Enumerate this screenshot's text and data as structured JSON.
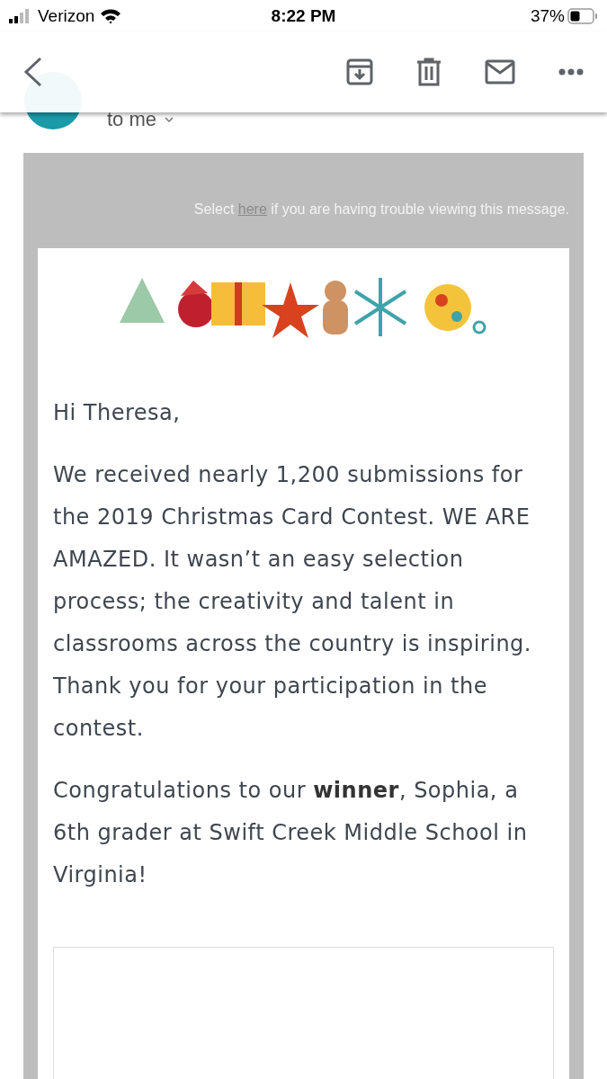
{
  "status_bar": {
    "carrier": "Verizon",
    "time": "8:22 PM",
    "battery": "37%"
  },
  "header": {
    "recipient": "to me"
  },
  "email": {
    "notice": {
      "before": "Select ",
      "link": "here",
      "after": " if you are having trouble viewing this message."
    },
    "paragraphs": [
      "Hi Theresa,",
      "We received nearly 1,200 submissions for the 2019 Christmas Card Contest. WE ARE AMAZED. It wasn’t an easy selection process; the creativity and talent in classrooms across the country is inspiring. Thank you for your participation in the contest.",
      "Congratulations to our **winner**, Sophia, a 6th grader at Swift Creek Middle School in Virginia!"
    ]
  }
}
